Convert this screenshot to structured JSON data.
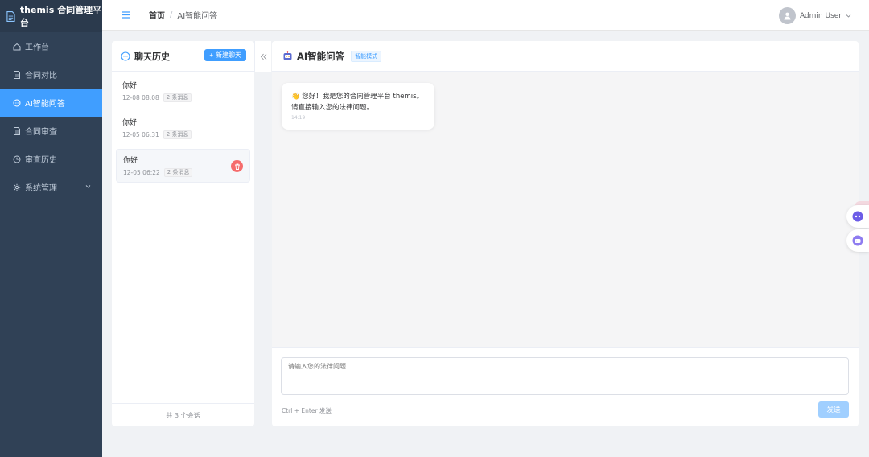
{
  "app": {
    "title": "themis 合同管理平台"
  },
  "sidebar": {
    "items": [
      {
        "label": "工作台",
        "icon": "home-icon"
      },
      {
        "label": "合同对比",
        "icon": "document-icon"
      },
      {
        "label": "AI智能问答",
        "icon": "chat-icon",
        "active": true
      },
      {
        "label": "合同审查",
        "icon": "document-icon"
      },
      {
        "label": "审查历史",
        "icon": "clock-icon"
      },
      {
        "label": "系统管理",
        "icon": "gear-icon",
        "has_submenu": true
      }
    ]
  },
  "header": {
    "breadcrumb": {
      "home": "首页",
      "separator": "/",
      "current": "AI智能问答"
    },
    "user": {
      "name": "Admin User"
    }
  },
  "history": {
    "title": "聊天历史",
    "new_chat_label": "新建聊天",
    "sessions": [
      {
        "title": "你好",
        "time": "12-08 08:08",
        "count": "2 条消息"
      },
      {
        "title": "你好",
        "time": "12-05 06:31",
        "count": "2 条消息"
      },
      {
        "title": "你好",
        "time": "12-05 06:22",
        "count": "2 条消息",
        "selected": true
      }
    ],
    "footer": "共 3 个会话"
  },
  "chat": {
    "title": "AI智能问答",
    "mode_tag": "智能模式",
    "messages": [
      {
        "text_line1": "👋 您好！我是您的合同管理平台 themis。",
        "text_line2": "请直接输入您的法律问题。",
        "time": "14:19"
      }
    ],
    "input_placeholder": "请输入您的法律问题...",
    "hint": "Ctrl + Enter 发送",
    "send_label": "发送"
  },
  "colors": {
    "sidebar_bg": "#304156",
    "accent": "#409eff",
    "danger": "#f56c6c"
  }
}
